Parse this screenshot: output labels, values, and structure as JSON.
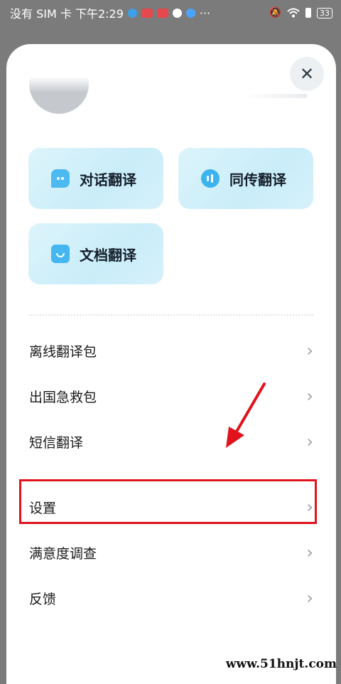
{
  "status_bar": {
    "left_text": "没有 SIM 卡 下午2:29",
    "more_indicator": "···",
    "battery": "33"
  },
  "header": {
    "close_glyph": "✕"
  },
  "features": [
    {
      "label": "对话翻译",
      "icon": "chat-bubble-icon"
    },
    {
      "label": "同传翻译",
      "icon": "soundwave-icon"
    },
    {
      "label": "文档翻译",
      "icon": "document-icon"
    }
  ],
  "menu": [
    {
      "label": "离线翻译包"
    },
    {
      "label": "出国急救包"
    },
    {
      "label": "短信翻译"
    },
    {
      "label": "设置"
    },
    {
      "label": "满意度调查"
    },
    {
      "label": "反馈"
    }
  ],
  "chevron_glyph": "›",
  "annotation_color": "#e0131c",
  "watermark": "www.51hnjt.com"
}
